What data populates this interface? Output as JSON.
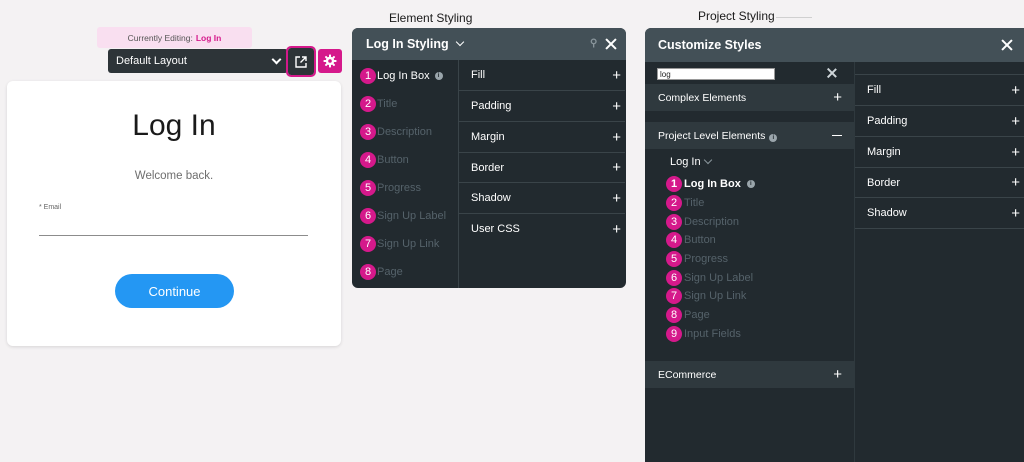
{
  "captions": {
    "element_styling": "Element Styling",
    "project_styling": "Project Styling"
  },
  "editor": {
    "currently_editing_label": "Currently Editing:",
    "currently_editing_value": "Log In",
    "layout_select_value": "Default Layout"
  },
  "login_preview": {
    "title": "Log In",
    "description": "Welcome back.",
    "email_label": "* Email",
    "continue_label": "Continue"
  },
  "element_panel": {
    "title": "Log In Styling",
    "elements": [
      {
        "num": "1",
        "label": "Log In Box"
      },
      {
        "num": "2",
        "label": "Title"
      },
      {
        "num": "3",
        "label": "Description"
      },
      {
        "num": "4",
        "label": "Button"
      },
      {
        "num": "5",
        "label": "Progress"
      },
      {
        "num": "6",
        "label": "Sign Up Label"
      },
      {
        "num": "7",
        "label": "Sign Up Link"
      },
      {
        "num": "8",
        "label": "Page"
      }
    ],
    "properties": [
      "Fill",
      "Padding",
      "Margin",
      "Border",
      "Shadow",
      "User CSS"
    ]
  },
  "project_panel": {
    "title": "Customize Styles",
    "search_value": "log",
    "groups": {
      "complex": "Complex Elements",
      "project_level": "Project Level Elements",
      "ecommerce": "ECommerce"
    },
    "sub_section": "Log In",
    "elements": [
      {
        "num": "1",
        "label": "Log In Box"
      },
      {
        "num": "2",
        "label": "Title"
      },
      {
        "num": "3",
        "label": "Description"
      },
      {
        "num": "4",
        "label": "Button"
      },
      {
        "num": "5",
        "label": "Progress"
      },
      {
        "num": "6",
        "label": "Sign Up Label"
      },
      {
        "num": "7",
        "label": "Sign Up Link"
      },
      {
        "num": "8",
        "label": "Page"
      },
      {
        "num": "9",
        "label": "Input Fields"
      }
    ],
    "properties": [
      "Fill",
      "Padding",
      "Margin",
      "Border",
      "Shadow"
    ]
  },
  "colors": {
    "accent": "#d5198b",
    "panel_bg": "#222a2f",
    "panel_header": "#435057",
    "button_blue": "#2497f3"
  }
}
